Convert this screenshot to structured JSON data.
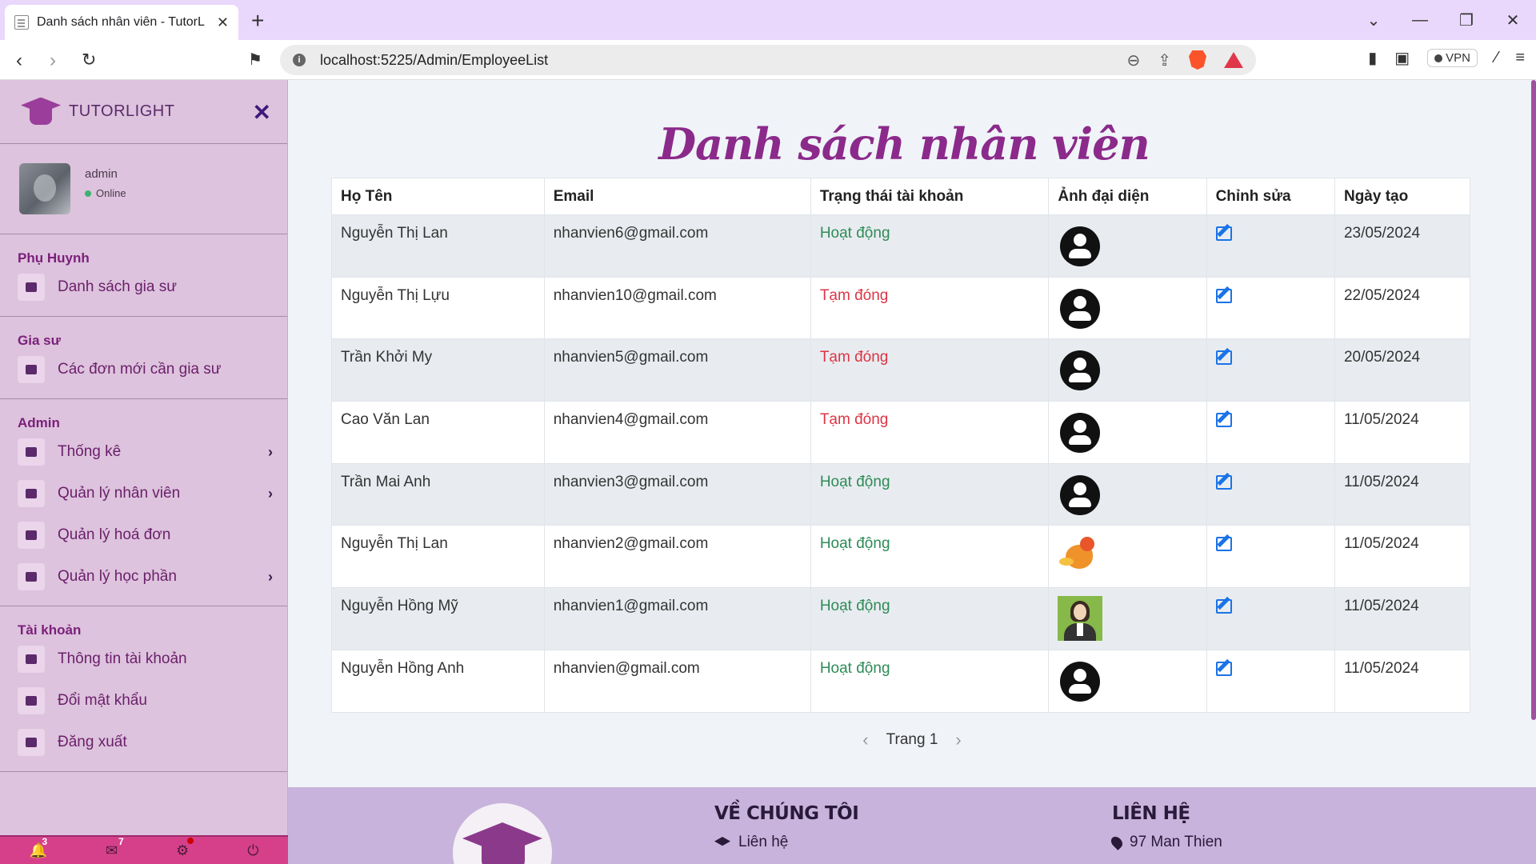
{
  "browser": {
    "tab_title": "Danh sách nhân viên - TutorLight",
    "url": "localhost:5225/Admin/EmployeeList",
    "vpn_label": "VPN"
  },
  "sidebar": {
    "brand": "TUTORLIGHT",
    "user": {
      "name": "admin",
      "status": "Online"
    },
    "sections": [
      {
        "heading": "Phụ Huynh",
        "items": [
          {
            "label": "Danh sách gia sư",
            "icon": "id-card-icon",
            "arrow": false
          }
        ]
      },
      {
        "heading": "Gia sư",
        "items": [
          {
            "label": "Các đơn mới cần gia sư",
            "icon": "calendar-icon",
            "arrow": false
          }
        ]
      },
      {
        "heading": "Admin",
        "items": [
          {
            "label": "Thống kê",
            "icon": "list-icon",
            "arrow": true
          },
          {
            "label": "Quản lý nhân viên",
            "icon": "laptop-icon",
            "arrow": true
          },
          {
            "label": "Quản lý hoá đơn",
            "icon": "invoice-icon",
            "arrow": false
          },
          {
            "label": "Quản lý học phần",
            "icon": "graduation-cap-icon",
            "arrow": true
          }
        ]
      },
      {
        "heading": "Tài khoản",
        "items": [
          {
            "label": "Thông tin tài khoản",
            "icon": "info-icon",
            "arrow": false
          },
          {
            "label": "Đổi mật khẩu",
            "icon": "lock-icon",
            "arrow": false
          },
          {
            "label": "Đăng xuất",
            "icon": "sign-out-icon",
            "arrow": false
          }
        ]
      }
    ],
    "footer": {
      "notifications": "3",
      "messages": "7"
    }
  },
  "main": {
    "title": "Danh sách nhân viên",
    "columns": [
      "Họ Tên",
      "Email",
      "Trạng thái tài khoản",
      "Ảnh đại diện",
      "Chỉnh sửa",
      "Ngày tạo"
    ],
    "rows": [
      {
        "name": "Nguyễn Thị Lan",
        "email": "nhanvien6@gmail.com",
        "status": "Hoạt động",
        "status_type": "active",
        "avatar": "default",
        "date": "23/05/2024"
      },
      {
        "name": "Nguyễn Thị Lựu",
        "email": "nhanvien10@gmail.com",
        "status": "Tạm đóng",
        "status_type": "closed",
        "avatar": "default",
        "date": "22/05/2024"
      },
      {
        "name": "Trần Khởi My",
        "email": "nhanvien5@gmail.com",
        "status": "Tạm đóng",
        "status_type": "closed",
        "avatar": "default",
        "date": "20/05/2024"
      },
      {
        "name": "Cao Văn Lan",
        "email": "nhanvien4@gmail.com",
        "status": "Tạm đóng",
        "status_type": "closed",
        "avatar": "default",
        "date": "11/05/2024"
      },
      {
        "name": "Trần Mai Anh",
        "email": "nhanvien3@gmail.com",
        "status": "Hoạt động",
        "status_type": "active",
        "avatar": "default",
        "date": "11/05/2024"
      },
      {
        "name": "Nguyễn Thị Lan",
        "email": "nhanvien2@gmail.com",
        "status": "Hoạt động",
        "status_type": "active",
        "avatar": "bird",
        "date": "11/05/2024"
      },
      {
        "name": "Nguyễn Hồng Mỹ",
        "email": "nhanvien1@gmail.com",
        "status": "Hoạt động",
        "status_type": "active",
        "avatar": "woman",
        "date": "11/05/2024"
      },
      {
        "name": "Nguyễn Hồng Anh",
        "email": "nhanvien@gmail.com",
        "status": "Hoạt động",
        "status_type": "active",
        "avatar": "default",
        "date": "11/05/2024"
      }
    ],
    "pagination": {
      "label": "Trang 1"
    },
    "colors": {
      "title": "#8b2a8b",
      "active": "#2e8b57",
      "closed": "#dc3545",
      "edit": "#1a73e8"
    }
  },
  "footer": {
    "about_heading": "VỀ CHÚNG TÔI",
    "about_line": "Liên hệ",
    "contact_heading": "LIÊN HỆ",
    "contact_line": "97 Man Thien"
  }
}
